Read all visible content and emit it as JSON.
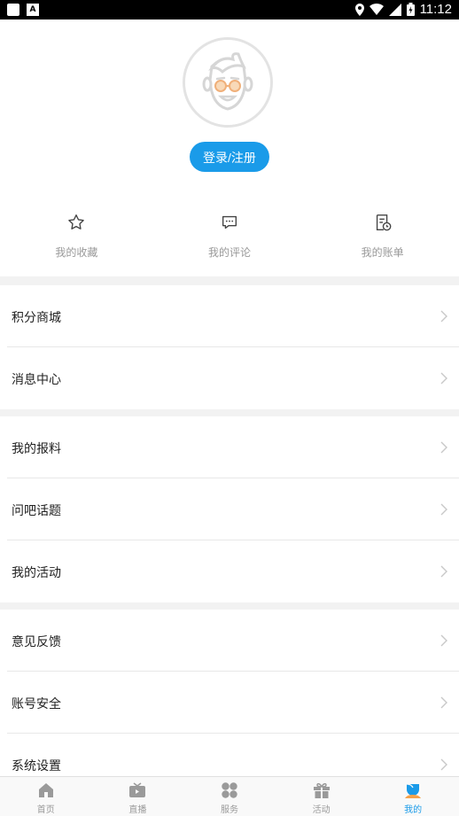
{
  "status_bar": {
    "time": "11:12"
  },
  "profile": {
    "login_button": "登录/注册"
  },
  "quick_actions": [
    {
      "label": "我的收藏",
      "icon": "star-icon"
    },
    {
      "label": "我的评论",
      "icon": "comment-icon"
    },
    {
      "label": "我的账单",
      "icon": "bill-icon"
    }
  ],
  "menu_groups": [
    [
      {
        "label": "积分商城"
      },
      {
        "label": "消息中心"
      }
    ],
    [
      {
        "label": "我的报料"
      },
      {
        "label": "问吧话题"
      },
      {
        "label": "我的活动"
      }
    ],
    [
      {
        "label": "意见反馈"
      },
      {
        "label": "账号安全"
      },
      {
        "label": "系统设置"
      }
    ]
  ],
  "tabs": [
    {
      "label": "首页",
      "icon": "home-icon"
    },
    {
      "label": "直播",
      "icon": "tv-icon"
    },
    {
      "label": "服务",
      "icon": "services-icon"
    },
    {
      "label": "活动",
      "icon": "gift-icon"
    },
    {
      "label": "我的",
      "icon": "user-icon",
      "active": true
    }
  ],
  "colors": {
    "accent": "#1a9be9",
    "muted": "#999999",
    "separator": "#f2f2f2"
  }
}
